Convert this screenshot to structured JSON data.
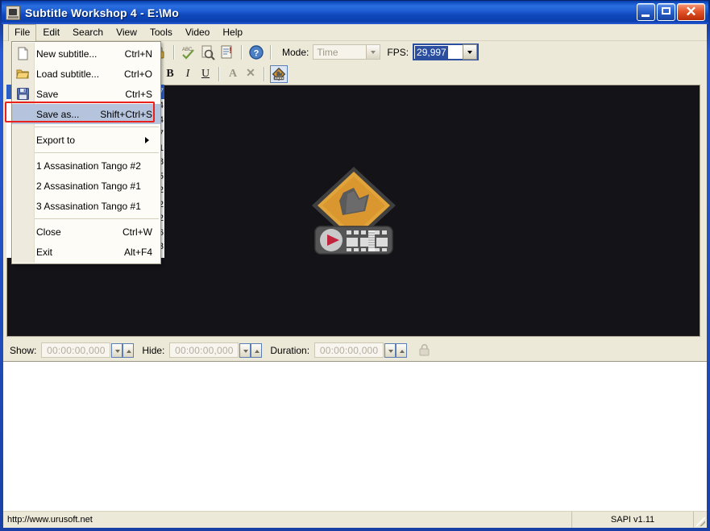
{
  "window": {
    "title": "Subtitle Workshop 4 - E:\\Mo",
    "icon": "app-icon",
    "buttons": {
      "minimize": "_",
      "maximize": "□",
      "close": "✕"
    }
  },
  "menubar": {
    "items": [
      {
        "label": "File",
        "open": true
      },
      {
        "label": "Edit",
        "open": false
      },
      {
        "label": "Search",
        "open": false
      },
      {
        "label": "View",
        "open": false
      },
      {
        "label": "Tools",
        "open": false
      },
      {
        "label": "Video",
        "open": false
      },
      {
        "label": "Help",
        "open": false
      }
    ]
  },
  "file_menu": {
    "items": [
      {
        "type": "item",
        "icon": "new-document-icon",
        "label": "New subtitle...",
        "accel": "Ctrl+N",
        "highlight": false
      },
      {
        "type": "item",
        "icon": "open-folder-icon",
        "label": "Load subtitle...",
        "accel": "Ctrl+O",
        "highlight": false
      },
      {
        "type": "item",
        "icon": "floppy-disk-icon",
        "label": "Save",
        "accel": "Ctrl+S",
        "highlight": false
      },
      {
        "type": "item",
        "icon": "",
        "label": "Save as...",
        "accel": "Shift+Ctrl+S",
        "highlight": true
      },
      {
        "type": "separator"
      },
      {
        "type": "submenu",
        "icon": "",
        "label": "Export to",
        "accel": "",
        "highlight": false
      },
      {
        "type": "separator"
      },
      {
        "type": "item",
        "icon": "",
        "label": "1 Assasination Tango #2",
        "accel": "",
        "highlight": false
      },
      {
        "type": "item",
        "icon": "",
        "label": "2 Assasination Tango #1",
        "accel": "",
        "highlight": false
      },
      {
        "type": "item",
        "icon": "",
        "label": "3 Assasination Tango #1",
        "accel": "",
        "highlight": false
      },
      {
        "type": "separator"
      },
      {
        "type": "item",
        "icon": "",
        "label": "Close",
        "accel": "Ctrl+W",
        "highlight": false
      },
      {
        "type": "item",
        "icon": "",
        "label": "Exit",
        "accel": "Alt+F4",
        "highlight": false
      }
    ],
    "annotation_color": "#e8211c",
    "annotated_item": "Save as..."
  },
  "toolbar": {
    "mode_label": "Mode:",
    "mode_value": "Time",
    "fps_label": "FPS:",
    "fps_value": "29,997",
    "icons_row1": [
      "lock-icon",
      "spellcheck-icon",
      "search-subtitle-icon",
      "subtitle-info-icon",
      "help-icon"
    ],
    "icons_row2": [
      "bold-icon",
      "italic-icon",
      "underline-icon",
      "font-color-icon",
      "clear-format-icon",
      "set-style-icon"
    ],
    "bold_glyph": "B",
    "italic_glyph": "I",
    "underline_glyph": "U",
    "font_color_glyph": "A",
    "clear_glyph": "✕"
  },
  "subtitle_list": {
    "rows": [
      "7",
      "4",
      "4",
      "7",
      "1",
      "8",
      "5",
      "2",
      "2",
      "2",
      "6",
      "3"
    ],
    "selected_index": 0
  },
  "video": {
    "logo_name": "media-player-classic-logo",
    "background_color": "#141318",
    "logo_colors": {
      "diamond_fill": "#d9952e",
      "diamond_border": "#4a4a4a",
      "body": "#5a5a5a",
      "play_button": "#c0233c"
    }
  },
  "timebar": {
    "show_label": "Show:",
    "show_value": "00:00:00,000",
    "hide_label": "Hide:",
    "hide_value": "00:00:00,000",
    "duration_label": "Duration:",
    "duration_value": "00:00:00,000",
    "lock_icon": "lock-duration-icon"
  },
  "text_editor": {
    "value": ""
  },
  "statusbar": {
    "left_text": "http://www.urusoft.net",
    "right_text": "SAPI v1.11",
    "grip": "resize-grip"
  }
}
